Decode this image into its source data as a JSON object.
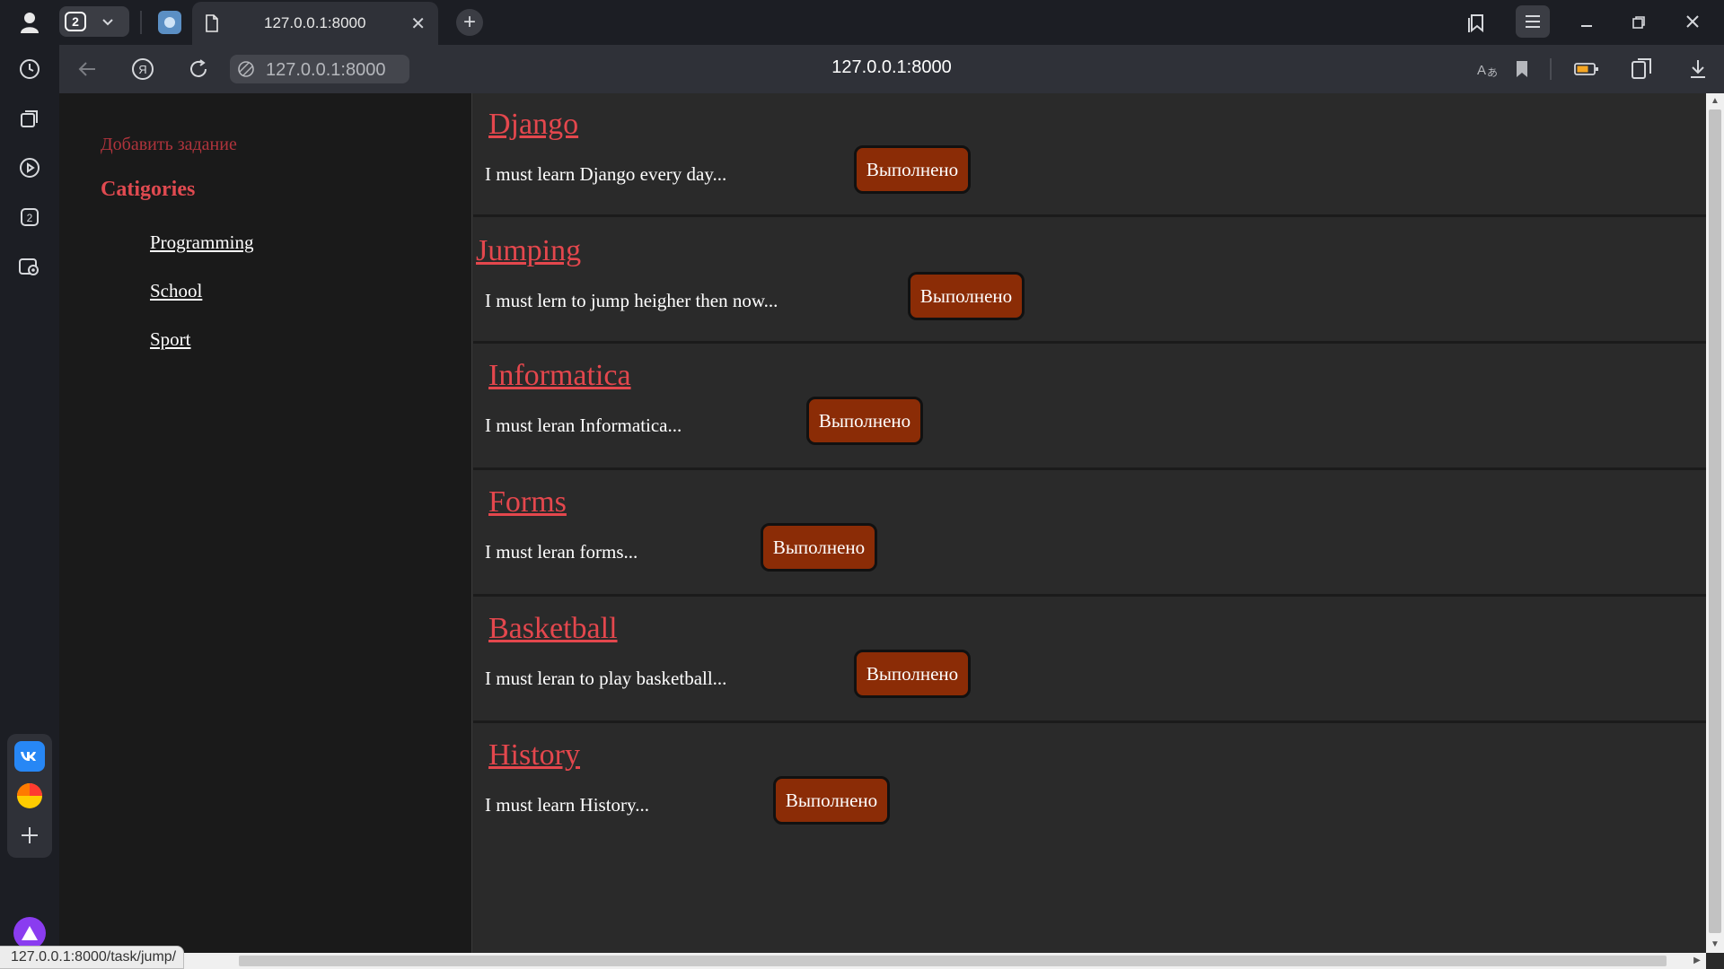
{
  "browser": {
    "tab_count": "2",
    "active_tab_title": "127.0.0.1:8000",
    "address_pill": "127.0.0.1:8000",
    "address_center": "127.0.0.1:8000",
    "status_url": "127.0.0.1:8000/task/jump/",
    "new_tab_glyph": "+",
    "close_glyph": "✕",
    "more_glyph": "•••"
  },
  "sidebar": {
    "add_task": "Добавить задание",
    "categories_title": "Catigories",
    "categories": [
      {
        "label": "Programming"
      },
      {
        "label": "School"
      },
      {
        "label": "Sport"
      }
    ]
  },
  "tasks": [
    {
      "title": "Django",
      "description": "I must learn Django every day...",
      "button": "Выполнено"
    },
    {
      "title": "Jumping",
      "description": "I must lern to jump heigher then now...",
      "button": "Выполнено"
    },
    {
      "title": "Informatica",
      "description": "I must leran Informatica...",
      "button": "Выполнено"
    },
    {
      "title": "Forms",
      "description": "I must leran forms...",
      "button": "Выполнено"
    },
    {
      "title": "Basketball",
      "description": "I must leran to play basketball...",
      "button": "Выполнено"
    },
    {
      "title": "History",
      "description": "I must learn History...",
      "button": "Выполнено"
    }
  ],
  "colors": {
    "accent_red": "#e4474d",
    "button_bg": "#8b2c06",
    "page_bg": "#2a2a2a",
    "sidebar_bg": "#1a1a1a"
  }
}
